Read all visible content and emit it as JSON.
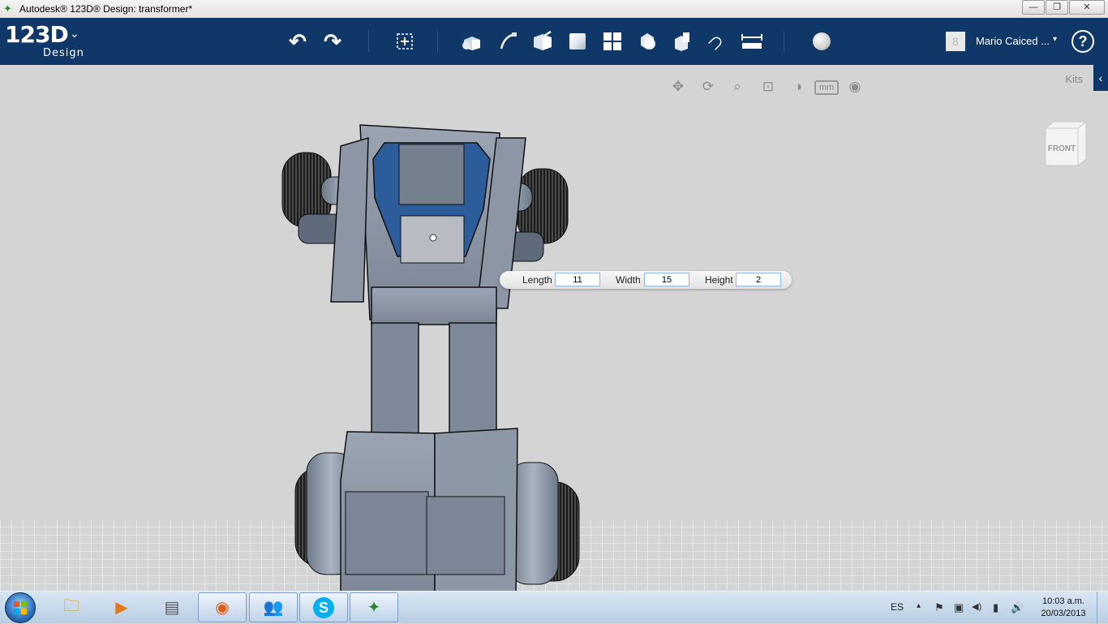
{
  "window": {
    "title": "Autodesk® 123D® Design: transformer*",
    "minimize_glyph": "—",
    "restore_glyph": "❐",
    "close_glyph": "✕"
  },
  "logo": {
    "main": "123D",
    "sub": "Design",
    "dropdown": "⌄"
  },
  "toolbar": {
    "icons": [
      "undo-icon",
      "redo-icon",
      "transform-icon",
      "primitives-icon",
      "sketch-icon",
      "construct-icon",
      "modify-icon",
      "pattern-icon",
      "grouping-icon",
      "combine-icon",
      "snap-icon",
      "measure-icon",
      "material-icon"
    ],
    "undo_glyph": "↶",
    "redo_glyph": "↷",
    "snap_glyph": "∩",
    "measure_glyph": "⟷"
  },
  "user": {
    "name": "Mario Caiced ...",
    "dropdown": "▾",
    "avatar_glyph": "8",
    "help": "?"
  },
  "viewport": {
    "kits_label": "Kits",
    "kits_arrow": "‹",
    "nav": {
      "pan": "✥",
      "orbit": "⟳",
      "zoom": "⌕",
      "fit": "⊡",
      "visual_style": "◑",
      "units": "mm",
      "eye": "◉"
    },
    "viewcube_label": "FRONT"
  },
  "dimensions": {
    "length_label": "Length",
    "length_value": "11",
    "width_label": "Width",
    "width_value": "15",
    "height_label": "Height",
    "height_value": "2"
  },
  "taskbar": {
    "apps": [
      "explorer",
      "media-player",
      "network",
      "firefox",
      "messenger",
      "skype",
      "123d-design"
    ],
    "app_glyphs": [
      "🗀",
      "▶",
      "▤",
      "◉",
      "👥",
      "S",
      "✦"
    ],
    "language": "ES",
    "tray_glyphs": {
      "arrow": "▴",
      "flag": "⚑",
      "device": "▣",
      "volume": "◀)",
      "signal": "▮",
      "speaker": "🔊"
    },
    "time": "10:03 a.m.",
    "date": "20/03/2013"
  },
  "colors": {
    "toolbar_bg": "#0f3768",
    "viewport_bg": "#d4d4d4",
    "model_blue": "#2c5c99",
    "model_gray": "#8a96a6"
  }
}
